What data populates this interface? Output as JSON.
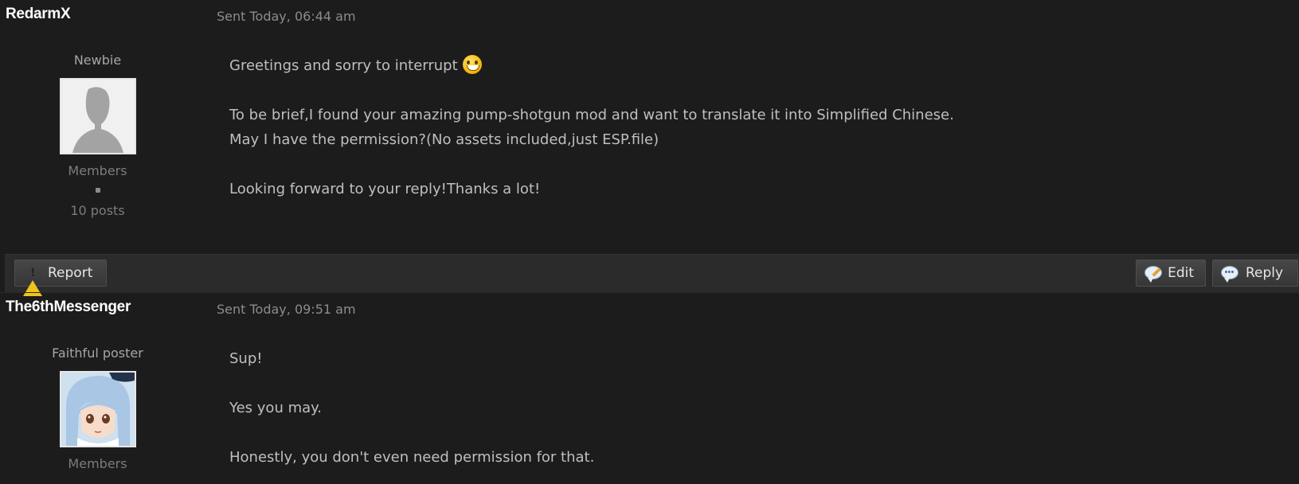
{
  "posts": [
    {
      "username": "RedarmX",
      "timestamp": "Sent Today, 06:44 am",
      "rank": "Newbie",
      "group": "Members",
      "posts_count": "10 posts",
      "body": {
        "line1": "Greetings and sorry to interrupt",
        "line2": "To be brief,I found your amazing pump-shotgun mod and want to translate it into Simplified Chinese.",
        "line3": "May I have the permission?(No assets included,just ESP.file)",
        "line4": "Looking forward to your reply!Thanks a lot!"
      },
      "actions": {
        "report": "Report",
        "edit": "Edit",
        "reply": "Reply"
      }
    },
    {
      "username": "The6thMessenger",
      "timestamp": "Sent Today, 09:51 am",
      "rank": "Faithful poster",
      "group": "Members",
      "body": {
        "line1": "Sup!",
        "line2": "Yes you may.",
        "line3": "Honestly, you don't even need permission for that."
      }
    }
  ],
  "colors": {
    "background": "#1c1c1c",
    "username": "#ffffff",
    "text": "#bfbfbf",
    "muted": "#8c8c8c",
    "action_bar": "#2b2b2b"
  }
}
